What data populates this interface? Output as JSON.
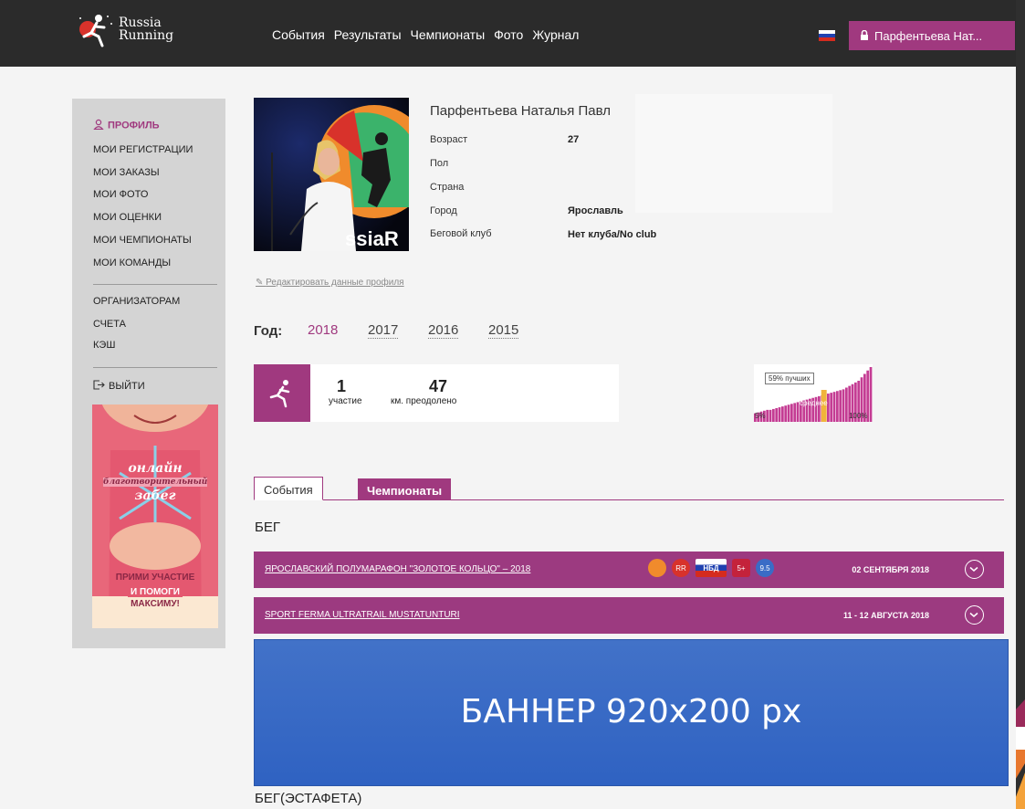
{
  "app": {
    "logo_line1": "Russia",
    "logo_line2": "Running"
  },
  "nav": [
    "События",
    "Результаты",
    "Чемпионаты",
    "Фото",
    "Журнал"
  ],
  "user_button": {
    "label": "Парфентьева Нат..."
  },
  "sidebar": {
    "profile": "ПРОФИЛЬ",
    "items": [
      "МОИ РЕГИСТРАЦИИ",
      "МОИ ЗАКАЗЫ",
      "МОИ ФОТО",
      "МОИ ОЦЕНКИ",
      "МОИ ЧЕМПИОНАТЫ",
      "МОИ КОМАНДЫ"
    ],
    "items2": [
      "ОРГАНИЗАТОРАМ",
      "СЧЕТА",
      "КЭШ"
    ],
    "logout": "ВЫЙТИ",
    "ad": {
      "line1": "онлайн",
      "line2": "благотворительный",
      "line3": "забег",
      "line4": "ПРИМИ УЧАСТИЕ",
      "line5": "И ПОМОГИ",
      "line6": "МАКСИМУ!"
    }
  },
  "profile": {
    "name": "Парфентьева Наталья Павл",
    "fields": [
      {
        "label": "Возраст",
        "value": "27"
      },
      {
        "label": "Пол",
        "value": ""
      },
      {
        "label": "Страна",
        "value": ""
      },
      {
        "label": "Город",
        "value": "Ярославль"
      },
      {
        "label": "Беговой клуб",
        "value": "Нет клуба/No club"
      }
    ],
    "edit_link": "Редактировать данные профиля"
  },
  "years": {
    "label": "Год:",
    "list": [
      "2018",
      "2017",
      "2016",
      "2015"
    ],
    "active": "2018"
  },
  "stats": {
    "participations": "1",
    "participations_label": "участие",
    "km": "47",
    "km_label": "км. преодолено",
    "hist_best": "59% пучших",
    "hist_avg": "среднее",
    "hist_min": "5%",
    "hist_max": "100%",
    "hist_percentile": 59,
    "hist_bars": [
      10,
      11,
      12,
      13,
      14,
      14,
      15,
      16,
      17,
      18,
      19,
      20,
      21,
      22,
      23,
      24,
      25,
      26,
      27,
      28,
      29,
      30,
      31,
      32,
      33,
      34,
      35,
      36,
      37,
      38,
      40,
      42,
      44,
      46,
      48,
      52,
      56,
      60,
      64
    ]
  },
  "tabs": [
    "События",
    "Чемпионаты"
  ],
  "sections": {
    "run": "БЕГ",
    "relay": "БЕГ(ЭСТАФЕТА)"
  },
  "events": [
    {
      "title": "ЯРОСЛАВСКИЙ ПОЛУМАРАФОН \"ЗОЛОТОЕ КОЛЬЦО\" – 2018",
      "date": "02 СЕНТЯБРЯ 2018",
      "badge_labels": [
        "",
        "RR",
        "НБД",
        "5+",
        "9.5"
      ]
    },
    {
      "title": "SPORT FERMA ULTRATRAIL MUSTATUNTURI",
      "date": "11 - 12 АВГУСТА 2018"
    }
  ],
  "banner": {
    "label": "БАННЕР 920x200 px"
  },
  "colors": {
    "brand": "#a0397f",
    "banner": "#3a6cc6",
    "topbar": "#2b2b2b"
  }
}
